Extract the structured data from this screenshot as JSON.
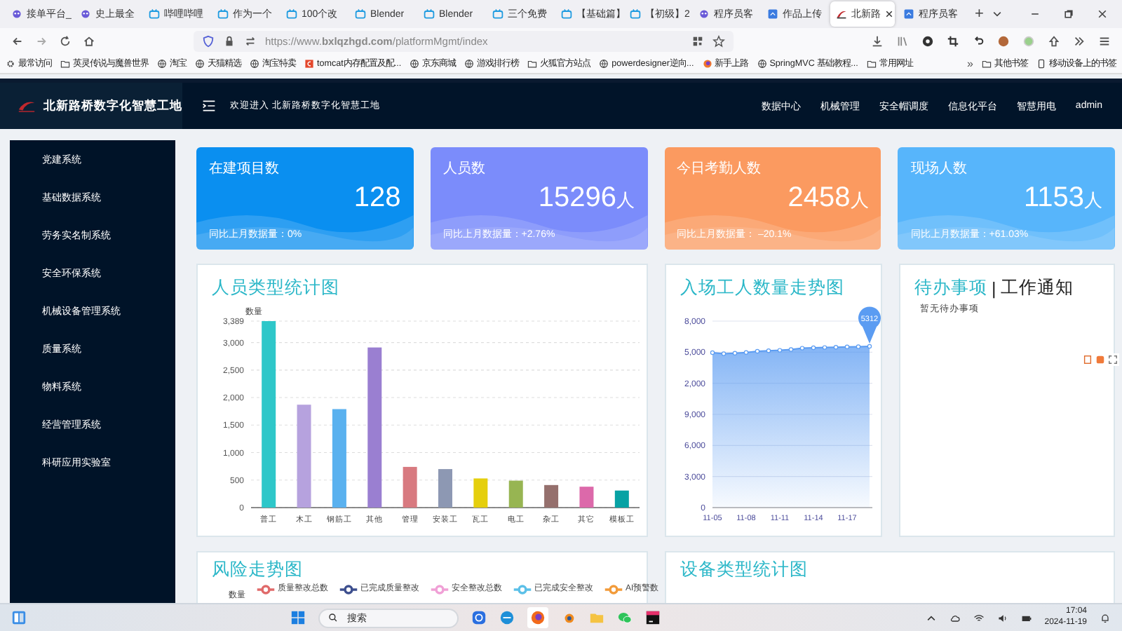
{
  "browser": {
    "tabs": [
      {
        "label": "接单平台_",
        "kind": "robot",
        "selected": false
      },
      {
        "label": "史上最全",
        "kind": "robot",
        "selected": false
      },
      {
        "label": "哔哩哔哩",
        "kind": "tv",
        "selected": false
      },
      {
        "label": "作为一个",
        "kind": "tv",
        "selected": false
      },
      {
        "label": "100个改",
        "kind": "tv",
        "selected": false
      },
      {
        "label": "Blender",
        "kind": "tv",
        "selected": false
      },
      {
        "label": "Blender",
        "kind": "tv",
        "selected": false
      },
      {
        "label": "三个免费",
        "kind": "tv",
        "selected": false
      },
      {
        "label": "【基础篇】",
        "kind": "tv",
        "selected": false
      },
      {
        "label": "【初级】2",
        "kind": "tv",
        "selected": false
      },
      {
        "label": "程序员客",
        "kind": "robot",
        "selected": false
      },
      {
        "label": "作品上传",
        "kind": "doc",
        "selected": false
      },
      {
        "label": "北新路",
        "kind": "logo",
        "selected": true
      },
      {
        "label": "程序员客",
        "kind": "doc",
        "selected": false
      }
    ],
    "new_tab": "+",
    "url": "https://www.**bxlqzhgd.com**/platformMgmt/index",
    "bookmarks": [
      {
        "label": "最常访问",
        "kind": "gear"
      },
      {
        "label": "英灵传说与魔兽世界",
        "kind": "folder"
      },
      {
        "label": "淘宝",
        "kind": "globe"
      },
      {
        "label": "天猫精选",
        "kind": "globe"
      },
      {
        "label": "淘宝特卖",
        "kind": "globe"
      },
      {
        "label": "tomcat内存配置及配...",
        "kind": "app"
      },
      {
        "label": "京东商城",
        "kind": "globe"
      },
      {
        "label": "游戏排行榜",
        "kind": "globe"
      },
      {
        "label": "火狐官方站点",
        "kind": "folder"
      },
      {
        "label": "powerdesigner逆向...",
        "kind": "globe"
      },
      {
        "label": "新手上路",
        "kind": "fox"
      },
      {
        "label": "SpringMVC 基础教程...",
        "kind": "globe"
      },
      {
        "label": "常用网址",
        "kind": "folder"
      }
    ],
    "bookmarks_more": "»",
    "bookmarks_right": [
      {
        "label": "其他书签",
        "kind": "folder"
      },
      {
        "label": "移动设备上的书签",
        "kind": "phone"
      }
    ]
  },
  "app": {
    "title": "北新路桥数字化智慧工地",
    "welcome": "欢迎进入 北新路桥数字化智慧工地",
    "nav": [
      "数据中心",
      "机械管理",
      "安全帽调度",
      "信息化平台",
      "智慧用电"
    ],
    "user": "admin",
    "sidebar": [
      "党建系统",
      "基础数据系统",
      "劳务实名制系统",
      "安全环保系统",
      "机械设备管理系统",
      "质量系统",
      "物料系统",
      "经营管理系统",
      "科研应用实验室"
    ],
    "cards": [
      {
        "title": "在建项目数",
        "value": "128",
        "color": "#0a8ff0",
        "change": "同比上月数据量：0%"
      },
      {
        "title": "人员数",
        "value": "15296",
        "unit": "人",
        "color": "#7b8cfb",
        "change": "同比上月数据量：+2.76%"
      },
      {
        "title": "今日考勤人数",
        "value": "2458",
        "unit": "人",
        "color": "#fb9a60",
        "change": "同比上月数据量： –20.1%"
      },
      {
        "title": "现场人数",
        "value": "1153",
        "unit": "人",
        "color": "#57b5fb",
        "change": "同比上月数据量：+61.03%"
      }
    ],
    "staff_chart": {
      "chart_data": {
        "type": "bar",
        "title": "人员类型统计图",
        "ylabel": "数量",
        "categories": [
          "普工",
          "木工",
          "钢筋工",
          "其他",
          "管理",
          "安装工",
          "瓦工",
          "电工",
          "杂工",
          "其它",
          "模板工"
        ],
        "series": [
          {
            "values": [
              3389,
              1870,
              1790,
              2910,
              740,
              700,
              530,
              490,
              410,
              380,
              310
            ]
          }
        ],
        "grid": true,
        "ylim": [
          0,
          3389
        ],
        "yticks": [
          {
            "value": 0,
            "label": "0"
          },
          {
            "value": 500,
            "label": "500"
          },
          {
            "value": 1000,
            "label": "1,000"
          },
          {
            "value": 1500,
            "label": "1,500"
          },
          {
            "value": 2000,
            "label": "2,000"
          },
          {
            "value": 2500,
            "label": "2,500"
          },
          {
            "value": 3000,
            "label": "3,000"
          },
          {
            "value": 3389,
            "label": "3,389"
          }
        ]
      }
    },
    "entry_chart": {
      "title": "入场工人数量走势图",
      "y_labels": [
        "8,000",
        "5,000",
        "2,000",
        "9,000",
        "6,000",
        "3,000",
        "0"
      ],
      "x_labels": [
        "11-05",
        "11-08",
        "11-11",
        "11-14",
        "11-17"
      ],
      "pin": "5312"
    },
    "todo": {
      "tabs": [
        {
          "label": "待办事项",
          "selected": true
        },
        {
          "label": "工作通知",
          "selected": false
        }
      ],
      "separator": "|",
      "empty": "暂无待办事项"
    },
    "risk_chart": {
      "title": "风险走势图",
      "ylabel": "数量",
      "legend": [
        {
          "name": "质量整改总数",
          "color": "#e06a6a"
        },
        {
          "name": "已完成质量整改",
          "color": "#3d4f8e"
        },
        {
          "name": "安全整改总数",
          "color": "#f0a0d6"
        },
        {
          "name": "已完成安全整改",
          "color": "#5cc0e8"
        },
        {
          "name": "AI预警数",
          "color": "#f29b3a"
        }
      ]
    },
    "device_chart": {
      "title": "设备类型统计图"
    }
  },
  "taskbar": {
    "search": "搜索",
    "time": "17:04",
    "date": "2024-11-19"
  }
}
